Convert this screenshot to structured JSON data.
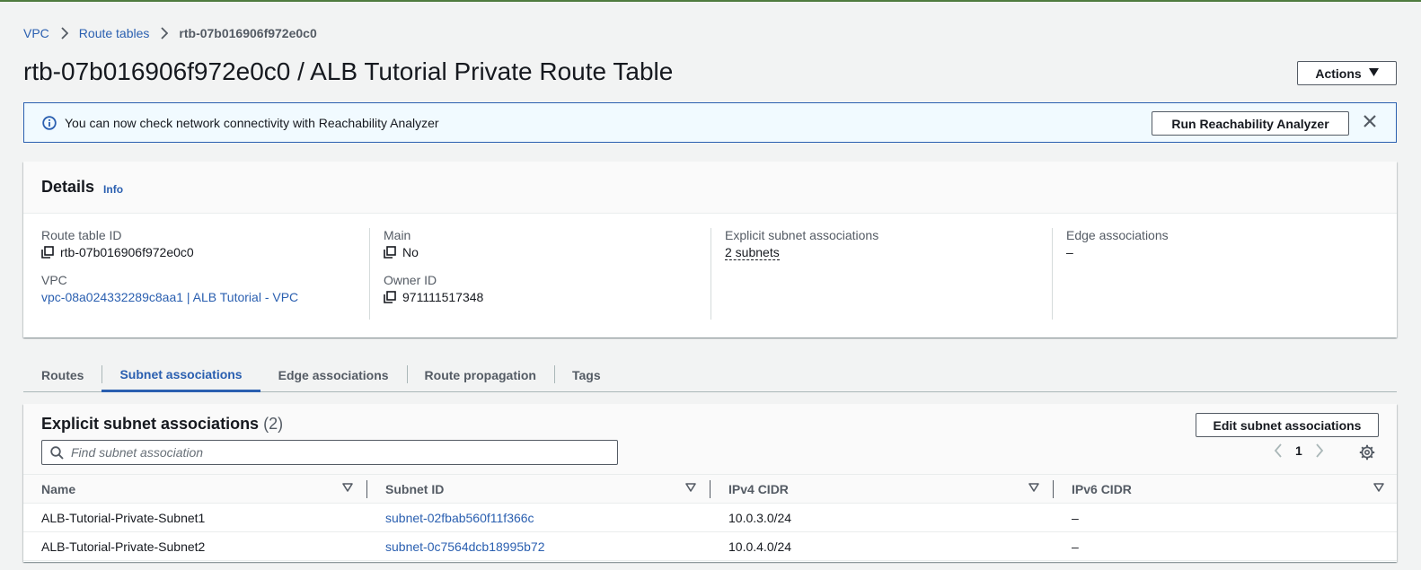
{
  "breadcrumb": {
    "items": [
      "VPC",
      "Route tables"
    ],
    "current": "rtb-07b016906f972e0c0"
  },
  "header": {
    "title": "rtb-07b016906f972e0c0 / ALB Tutorial Private Route Table",
    "actions_label": "Actions"
  },
  "alert": {
    "text": "You can now check network connectivity with Reachability Analyzer",
    "button_label": "Run Reachability Analyzer"
  },
  "details": {
    "title": "Details",
    "info_label": "Info",
    "route_table_id_label": "Route table ID",
    "route_table_id": "rtb-07b016906f972e0c0",
    "vpc_label": "VPC",
    "vpc_value": "vpc-08a024332289c8aa1 | ALB Tutorial - VPC",
    "main_label": "Main",
    "main_value": "No",
    "owner_id_label": "Owner ID",
    "owner_id": "971111517348",
    "explicit_label": "Explicit subnet associations",
    "explicit_value": "2 subnets",
    "edge_label": "Edge associations",
    "edge_value": "–"
  },
  "tabs": [
    "Routes",
    "Subnet associations",
    "Edge associations",
    "Route propagation",
    "Tags"
  ],
  "subnet_panel": {
    "title": "Explicit subnet associations",
    "count": "(2)",
    "edit_label": "Edit subnet associations",
    "search_placeholder": "Find subnet association",
    "page": "1",
    "columns": [
      "Name",
      "Subnet ID",
      "IPv4 CIDR",
      "IPv6 CIDR"
    ],
    "rows": [
      {
        "name": "ALB-Tutorial-Private-Subnet1",
        "subnet_id": "subnet-02fbab560f11f366c",
        "ipv4": "10.0.3.0/24",
        "ipv6": "–"
      },
      {
        "name": "ALB-Tutorial-Private-Subnet2",
        "subnet_id": "subnet-0c7564dcb18995b72",
        "ipv4": "10.0.4.0/24",
        "ipv6": "–"
      }
    ]
  },
  "colors": {
    "link": "#2a5fb0",
    "alert_border": "#2a5fb0",
    "alert_bg": "#f1faff",
    "top_bar": "#4f7b3f"
  },
  "icons": {
    "breadcrumb_separator": "chevron-right-icon",
    "alert": "info-circle-icon",
    "dismiss": "close-icon",
    "copy": "copy-icon",
    "search": "search-icon",
    "settings": "gear-icon"
  }
}
